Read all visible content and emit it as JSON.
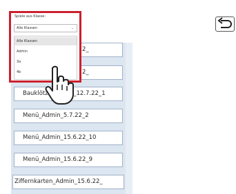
{
  "filter": {
    "label": "Spiele aus Klasse:",
    "selected_value": "Alle Klassen",
    "options": [
      "Alle Klassen",
      "Admin",
      "3a",
      "4b"
    ]
  },
  "game_list": [
    "Menü_Admin_12.7.22_",
    "Menü_Admin_12.7.22_",
    "Bauklötze_Admin_12.7.22_1",
    "Menü_Admin_5.7.22_2",
    "Menü_Admin_15.6.22_10",
    "Menü_Admin_15.6.22_9",
    "Ziffernkarten_Admin_15.6.22_"
  ],
  "icons": {
    "back": "undo-arrow-icon",
    "cursor": "hand-pointer-icon",
    "select": "chevron-down-icon"
  },
  "colors": {
    "highlight_border": "#cc1f2e",
    "list_background": "#dce6f0"
  }
}
